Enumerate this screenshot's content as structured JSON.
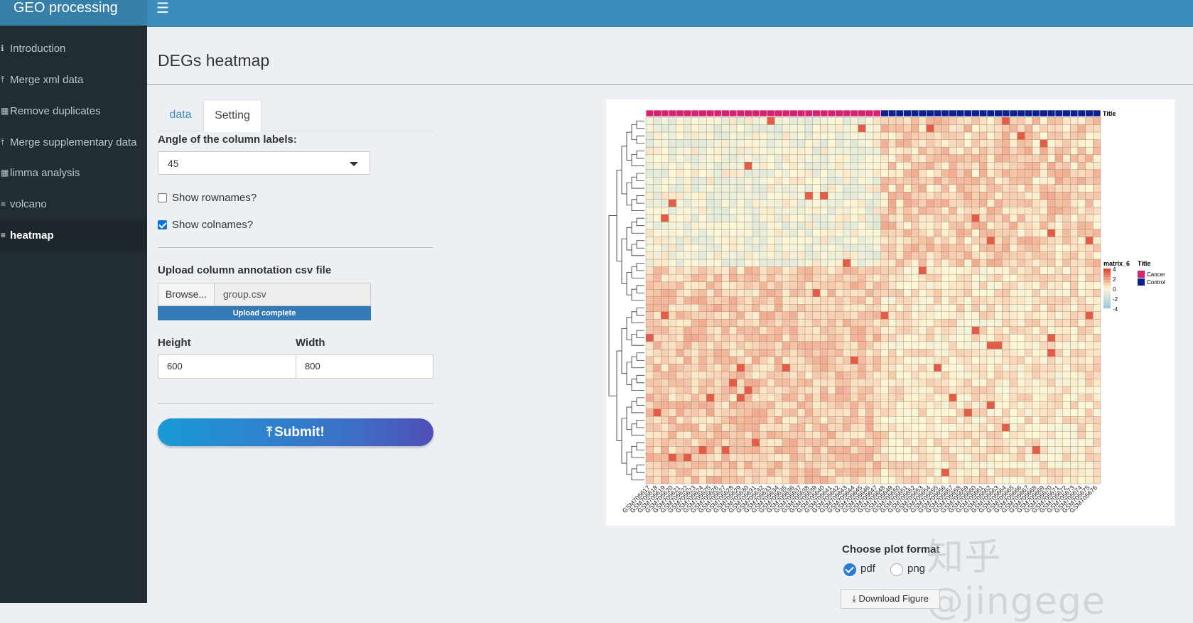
{
  "app": {
    "title": "GEO processing"
  },
  "sidebar": {
    "items": [
      {
        "label": "Introduction",
        "icon": "info-circle-icon",
        "glyph": "ℹ",
        "active": false
      },
      {
        "label": "Merge xml data",
        "icon": "upload-icon",
        "glyph": "⤒",
        "active": false
      },
      {
        "label": "Remove duplicates",
        "icon": "table-icon",
        "glyph": "▦",
        "active": false
      },
      {
        "label": "Merge supplementary data",
        "icon": "upload-icon",
        "glyph": "⤒",
        "active": false
      },
      {
        "label": "limma analysis",
        "icon": "table-icon",
        "glyph": "▦",
        "active": false
      },
      {
        "label": "volcano",
        "icon": "bar-chart-icon",
        "glyph": "≡",
        "active": false
      },
      {
        "label": "heatmap",
        "icon": "bar-chart-icon",
        "glyph": "≡",
        "active": true
      }
    ]
  },
  "page": {
    "title": "DEGs heatmap"
  },
  "tabs": [
    {
      "label": "data",
      "active": false
    },
    {
      "label": "Setting",
      "active": true
    }
  ],
  "settings": {
    "angle_label": "Angle of the column labels:",
    "angle_value": "45",
    "show_rownames_label": "Show rownames?",
    "show_rownames": false,
    "show_colnames_label": "Show colnames?",
    "show_colnames": true,
    "upload_label": "Upload column annotation csv file",
    "browse_label": "Browse...",
    "file_name": "group.csv",
    "upload_status": "Upload complete",
    "height_label": "Height",
    "height_value": "600",
    "width_label": "Width",
    "width_value": "800",
    "submit_label": "Submit!"
  },
  "plot_format": {
    "label": "Choose plot format",
    "options": [
      {
        "label": "pdf",
        "selected": true
      },
      {
        "label": "png",
        "selected": false
      }
    ]
  },
  "download_label": "Download Figure",
  "watermark": "知乎 @jingege",
  "heatmap": {
    "annotation_title": "Title",
    "legend_matrix_title": "matrix_6",
    "legend_values": [
      "4",
      "2",
      "0",
      "-2",
      "-4"
    ],
    "groups": [
      {
        "name": "Cancer",
        "color": "#d6246e",
        "count": 31
      },
      {
        "name": "Control",
        "color": "#0c1f8c",
        "count": 29
      }
    ],
    "col_names": [
      "GSM705617",
      "GSM705618",
      "GSM705619",
      "GSM705620",
      "GSM705621",
      "GSM705622",
      "GSM705623",
      "GSM705624",
      "GSM705625",
      "GSM705626",
      "GSM705627",
      "GSM705628",
      "GSM705629",
      "GSM705630",
      "GSM705631",
      "GSM705632",
      "GSM705633",
      "GSM705634",
      "GSM705635",
      "GSM705636",
      "GSM705637",
      "GSM705638",
      "GSM705639",
      "GSM705640",
      "GSM705641",
      "GSM705642",
      "GSM705643",
      "GSM705644",
      "GSM705645",
      "GSM705646",
      "GSM705647",
      "GSM705648",
      "GSM705649",
      "GSM705650",
      "GSM705651",
      "GSM705652",
      "GSM705653",
      "GSM705654",
      "GSM705655",
      "GSM705656",
      "GSM705657",
      "GSM705658",
      "GSM705659",
      "GSM705660",
      "GSM705661",
      "GSM705662",
      "GSM705663",
      "GSM705664",
      "GSM705665",
      "GSM705666",
      "GSM705667",
      "GSM705668",
      "GSM705669",
      "GSM705670",
      "GSM705671",
      "GSM705672",
      "GSM705673",
      "GSM705674",
      "GSM705675",
      "GSM705676"
    ],
    "n_rows": 49,
    "cold_color": "#9ecae1",
    "zero_color": "#fff7d6",
    "hot_color": "#e34a33"
  }
}
